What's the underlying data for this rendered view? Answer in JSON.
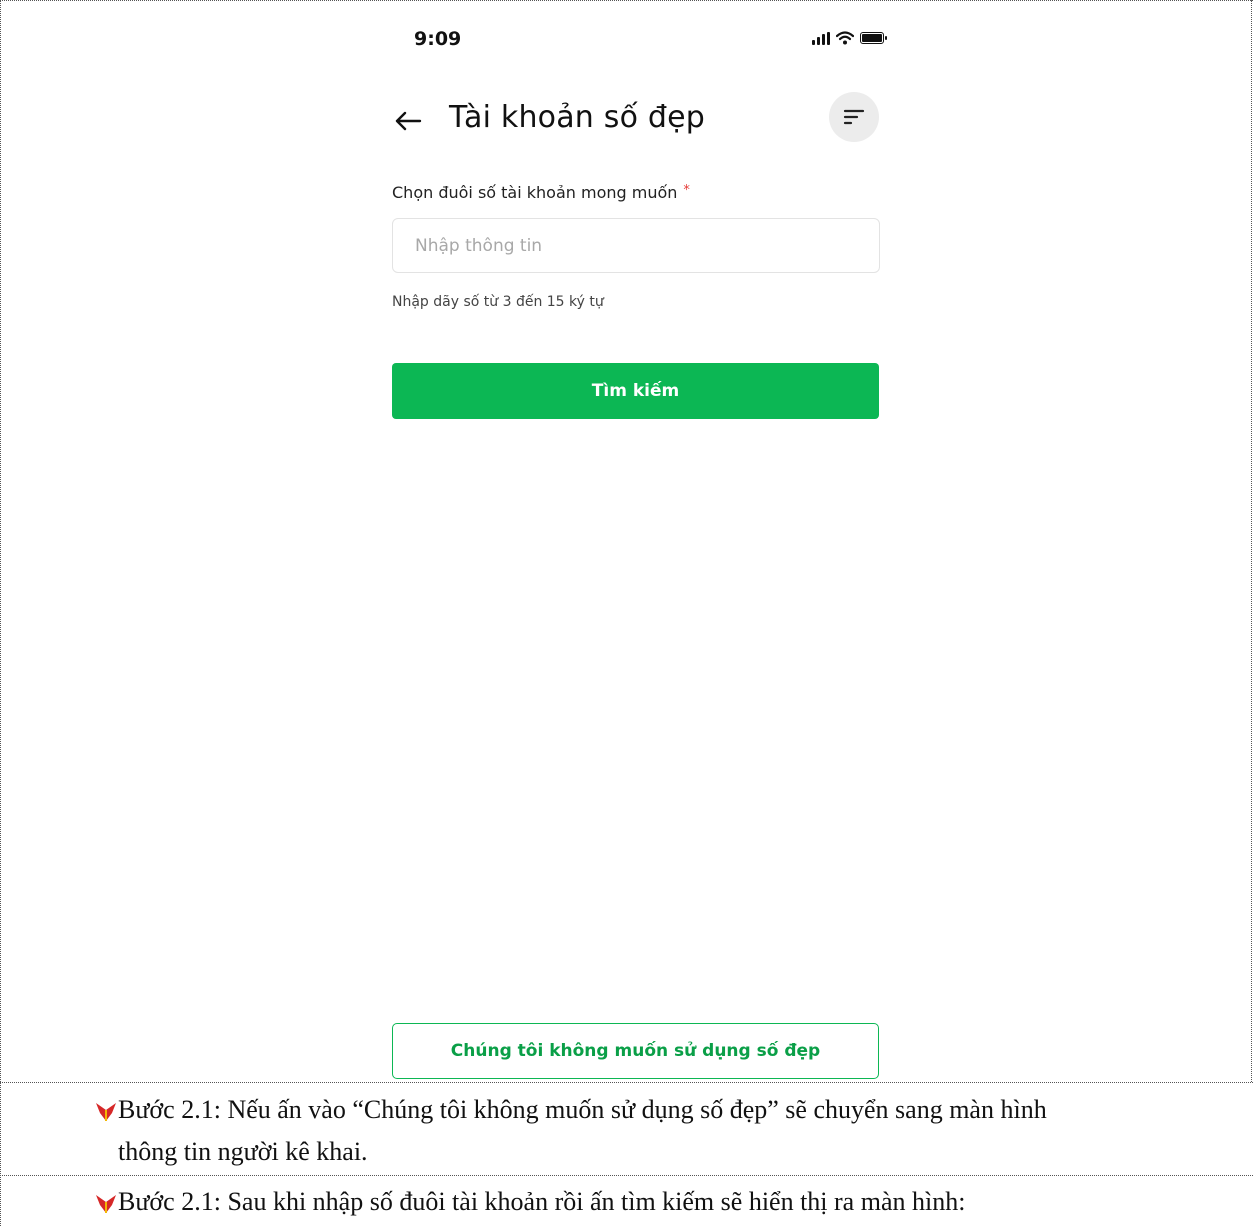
{
  "status_bar": {
    "time": "9:09",
    "icons": [
      "signal-icon",
      "wifi-icon",
      "battery-icon"
    ]
  },
  "header": {
    "title": "Tài khoản số đẹp",
    "back_icon": "arrow-left-icon",
    "filter_icon": "filter-lines-icon"
  },
  "form": {
    "label": "Chọn đuôi số tài khoản mong muốn",
    "required_mark": "*",
    "input_value": "",
    "input_placeholder": "Nhập thông tin",
    "helper": "Nhập dãy số từ 3 đến 15 ký tự",
    "search_button": "Tìm kiếm"
  },
  "footer": {
    "skip_button": "Chúng tôi không muốn sử dụng số đẹp"
  },
  "document": {
    "step1_line1": "Bước 2.1: Nếu ấn vào “Chúng tôi không muốn sử dụng số đẹp” sẽ chuyển sang màn hình",
    "step1_line2": "thông tin người kê khai.",
    "step2_line1": "Bước 2.1: Sau khi nhập số đuôi tài khoản rồi ấn tìm kiếm sẽ hiển thị ra màn hình:"
  },
  "colors": {
    "primary_green": "#0cb754",
    "required_red": "#e53935",
    "bullet_red": "#d62828",
    "bullet_yellow": "#f2b705"
  }
}
